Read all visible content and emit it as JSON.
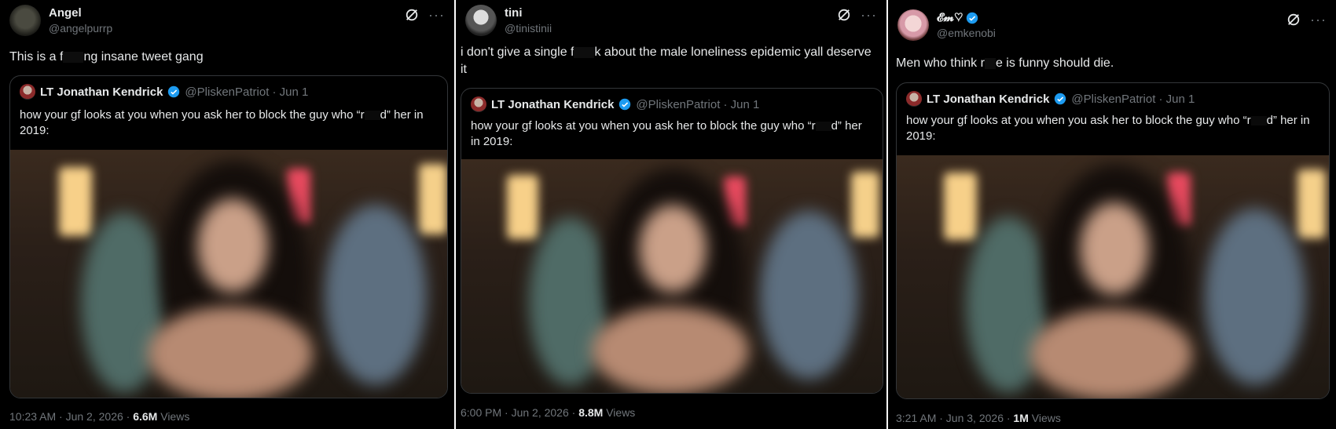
{
  "tweets": [
    {
      "display_name": "Angel",
      "handle": "@angelpurrp",
      "text_before": "This is a f",
      "text_after": "ng insane tweet gang",
      "timestamp": "10:23 AM · Jun 2, 2026 · ",
      "views_count": "6.6M",
      "views_label": " Views",
      "icons": [
        "grok-icon",
        "more-icon"
      ]
    },
    {
      "display_name": "tini",
      "handle": "@tinistinii",
      "text_before": "i don't give a single f",
      "text_after": "k about the male loneliness epidemic yall deserve it",
      "timestamp": "6:00 PM · Jun 2, 2026 · ",
      "views_count": "8.8M",
      "views_label": " Views",
      "icons": [
        "grok-icon",
        "more-icon"
      ]
    },
    {
      "display_name": "𝓔𝓶♡",
      "handle": "@emkenobi",
      "text_before": "Men who think r",
      "text_after": "e is funny should die.",
      "timestamp": "3:21 AM · Jun 3, 2026 · ",
      "views_count": "1M",
      "views_label": " Views",
      "icons": [
        "grok-icon",
        "more-icon"
      ]
    }
  ],
  "quoted": {
    "display_name": "LT Jonathan Kendrick",
    "handle_date": "@PliskenPatriot · Jun 1",
    "text_before": "how your gf looks at you when you ask her to block the guy who “r",
    "text_after": "d” her in 2019:"
  },
  "colors": {
    "background": "#000000",
    "text": "#e7e9ea",
    "muted": "#71767b",
    "border": "#333639",
    "verified": "#1d9bf0"
  }
}
